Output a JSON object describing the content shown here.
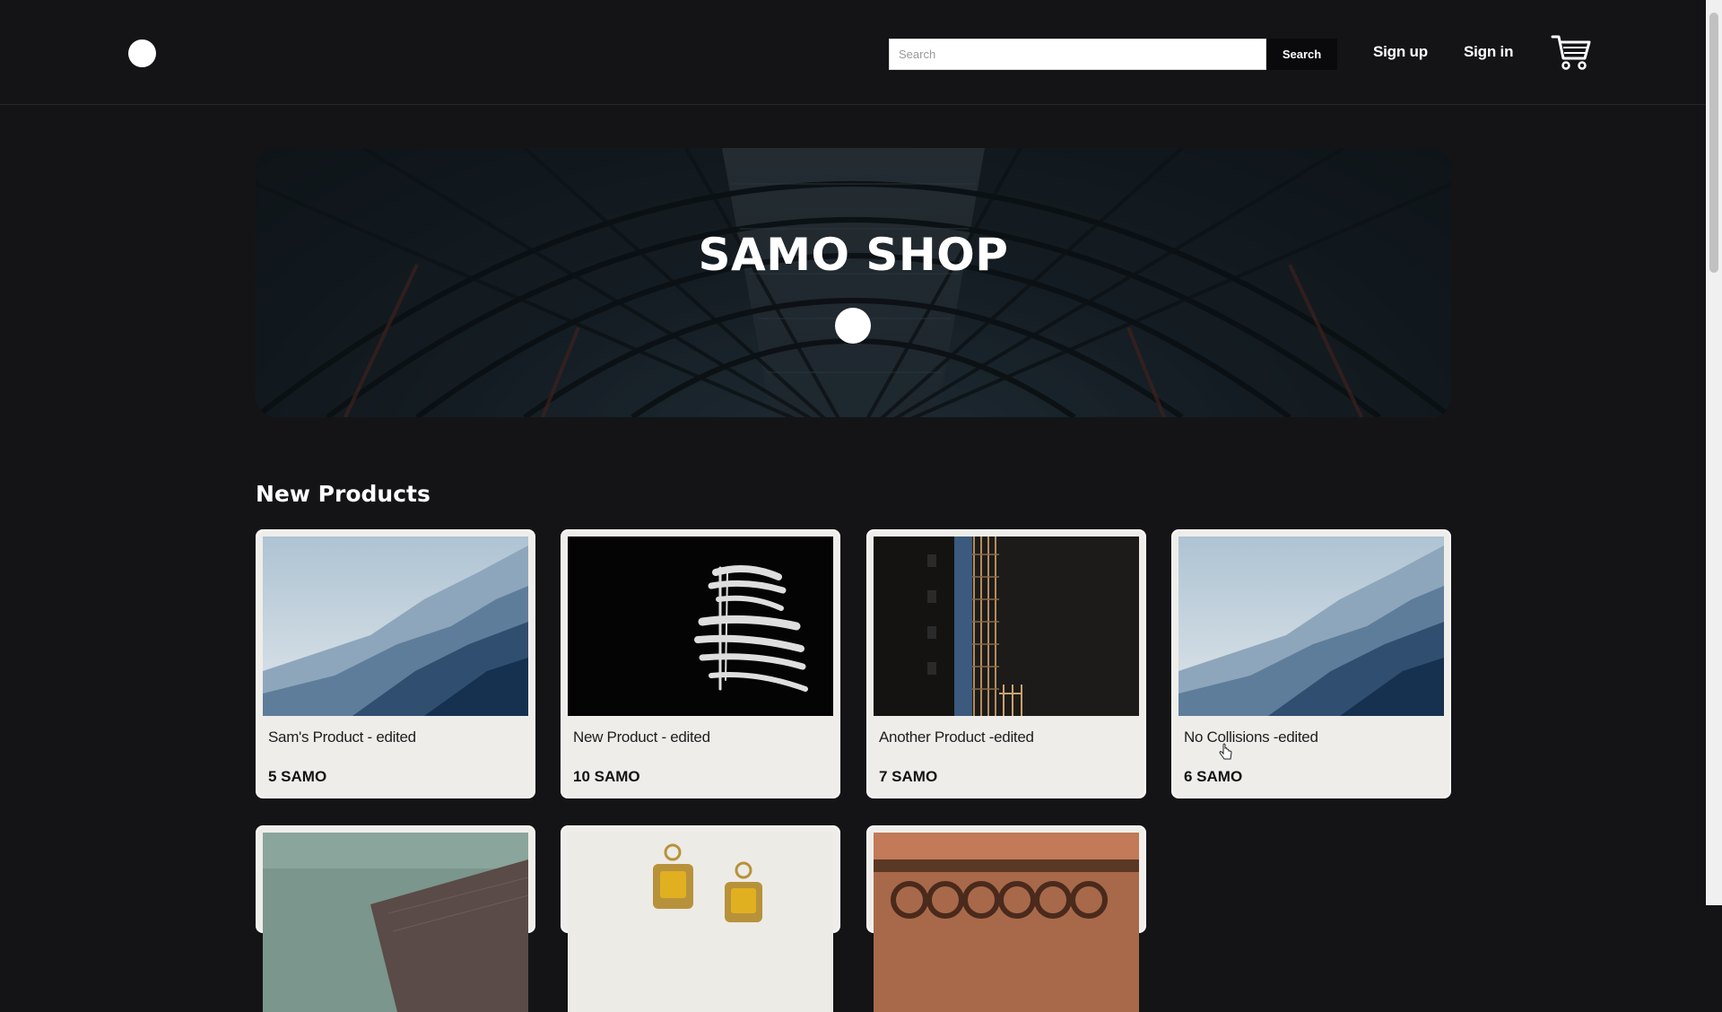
{
  "header": {
    "search_placeholder": "Search",
    "search_button": "Search",
    "signup": "Sign up",
    "signin": "Sign in"
  },
  "hero": {
    "title": "SAMO SHOP"
  },
  "section": {
    "title": "New Products"
  },
  "products": [
    {
      "name": "Sam's Product - edited",
      "price": "5 SAMO",
      "image": "mountain-landscape"
    },
    {
      "name": "New Product - edited",
      "price": "10 SAMO",
      "image": "white-brush-strokes"
    },
    {
      "name": "Another Product -edited",
      "price": "7 SAMO",
      "image": "building-at-night"
    },
    {
      "name": "No Collisions -edited",
      "price": "6 SAMO",
      "image": "mountain-landscape"
    },
    {
      "name": "",
      "price": "",
      "image": "green-wall-with-mesh"
    },
    {
      "name": "",
      "price": "",
      "image": "yellow-gem-charms"
    },
    {
      "name": "",
      "price": "",
      "image": "rusty-rings"
    }
  ],
  "colors": {
    "page_background": "#141417",
    "card_background": "#efedea",
    "accent": "#ffffff"
  }
}
